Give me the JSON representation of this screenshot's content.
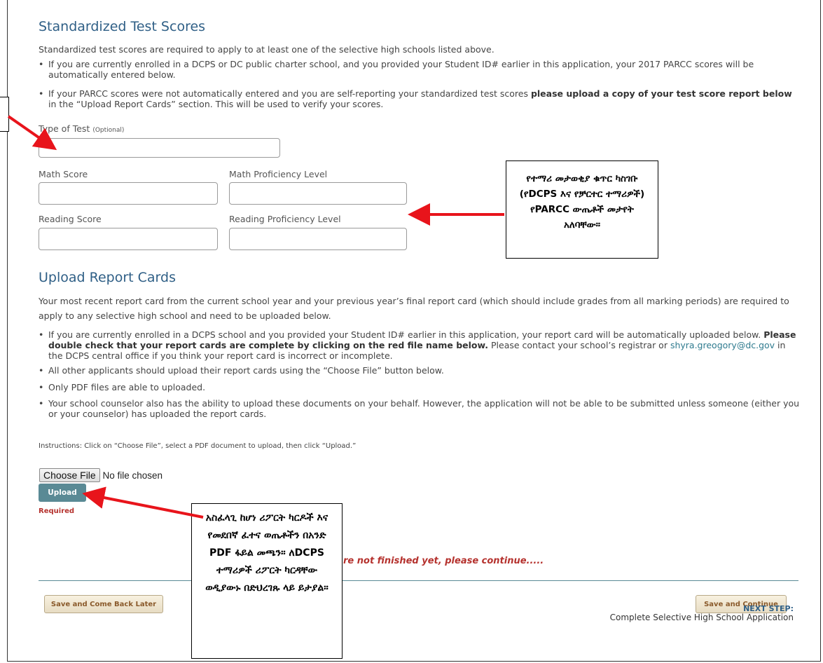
{
  "scores": {
    "heading": "Standardized Test Scores",
    "intro": "Standardized test scores are required to apply to at least one of the selective high schools listed above.",
    "bullet1": "If you are currently enrolled in a DCPS or DC public charter school, and you provided your Student ID# earlier in this application, your 2017 PARCC scores will be automatically entered below.",
    "bullet2_pre": "If your PARCC scores were not automatically entered and you are self-reporting your standardized test scores ",
    "bullet2_bold": "please upload a copy of your test score report below",
    "bullet2_post": " in the “Upload Report Cards” section. This will be used to verify your scores.",
    "type_label": "Type of Test",
    "type_optional": "(Optional)",
    "math_score": "Math Score",
    "math_level": "Math Proficiency Level",
    "reading_score": "Reading Score",
    "reading_level": "Reading Proficiency Level"
  },
  "upload": {
    "heading": "Upload Report Cards",
    "intro": "Your most recent report card from the current school year and your previous year’s final report card (which should include grades from all marking periods) are required to apply to any selective high school and need to be uploaded below.",
    "b1_pre": "If you are currently enrolled in a DCPS school and you provided your Student ID# earlier in this application, your report card will be automatically uploaded below.",
    "b1_bold": "Please double check that your report cards are complete by clicking on the red file name below.",
    "b1_mid": " Please contact your school’s registrar or ",
    "b1_email": "shyra.greogory@dc.gov",
    "b1_post": " in the DCPS central office if you think your report card is incorrect or incomplete.",
    "b2": "All other applicants should upload their report cards using the “Choose File” button below.",
    "b3": "Only PDF files are able to uploaded.",
    "b4": "Your school counselor also has the ability to upload these documents on your behalf. However, the application will not be able to be submitted unless someone (either you or your counselor) has uploaded the report cards.",
    "instructions": "Instructions: Click on “Choose File”, select a PDF document to upload, then click “Upload.”",
    "choose_file": "Choose File",
    "no_file": "No file chosen",
    "upload_btn": "Upload",
    "required": "Required"
  },
  "footer": {
    "not_finished": "re not finished yet, please continue.....",
    "save_later": "Save and Come Back Later",
    "save_continue": "Save and Continue",
    "next_step": "NEXT STEP:",
    "next_desc": "Complete Selective High School Application"
  },
  "callouts": {
    "parcc": "የተማሪ መታወቂያ ቁጥር ካስገቡ (የDCPS እና የቻርተር ተማሪዎች) የPARCC ውጤቶች መታየት አለባቸው።",
    "pdf": "አስፈላጊ ከሆነ ሪፖርት ካርዶች እና የመደበኛ ፈተና ወጤቶችን በአንድ PDF ፋይል መጫን። ለDCPS ተማሪዎች ሪፖርት ካርዳቸው ወዲያውኑ በድህረገጹ ላይ ይታያል።"
  },
  "colors": {
    "heading": "#2f5f86",
    "arrow": "#e8141b",
    "required": "#b5322e",
    "upload_btn": "#5a8a95"
  }
}
